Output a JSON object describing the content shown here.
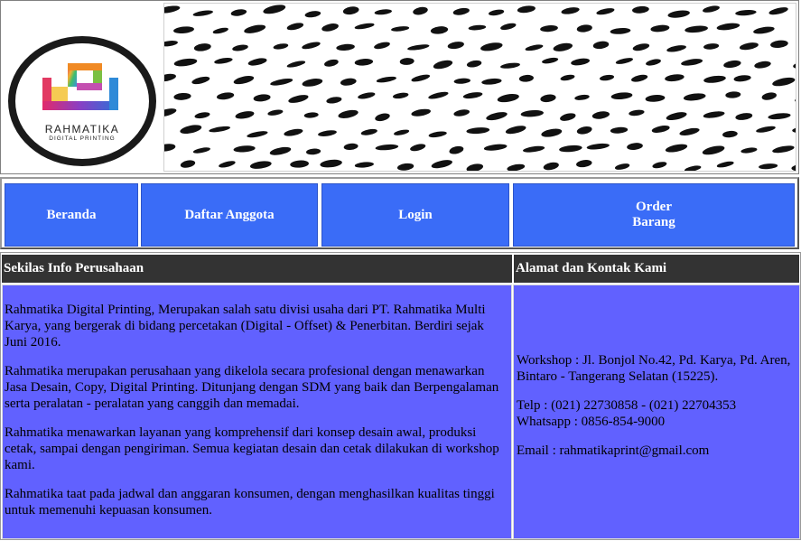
{
  "logo": {
    "name": "RAHMATIKA",
    "tagline": "DIGITAL PRINTING"
  },
  "nav": {
    "items": [
      {
        "label": "Beranda"
      },
      {
        "label": "Daftar Anggota"
      },
      {
        "label": "Login"
      },
      {
        "label": "Order Barang"
      }
    ]
  },
  "info": {
    "heading": "Sekilas Info Perusahaan",
    "paragraphs": [
      "Rahmatika Digital Printing, Merupakan salah satu divisi usaha dari PT. Rahmatika Multi Karya, yang bergerak di bidang percetakan (Digital - Offset) & Penerbitan. Berdiri sejak Juni 2016.",
      "Rahmatika merupakan perusahaan yang dikelola secara profesional dengan menawarkan Jasa Desain, Copy, Digital Printing. Ditunjang dengan SDM yang baik dan Berpengalaman serta peralatan - peralatan yang canggih dan memadai.",
      "Rahmatika menawarkan layanan yang komprehensif dari konsep desain awal, produksi cetak, sampai dengan pengiriman. Semua kegiatan desain dan cetak dilakukan di workshop kami.",
      "Rahmatika taat pada jadwal dan anggaran konsumen, dengan menghasilkan kualitas tinggi untuk memenuhi kepuasan konsumen."
    ]
  },
  "contact": {
    "heading": "Alamat dan Kontak Kami",
    "workshop": "Workshop : Jl. Bonjol No.42, Pd. Karya, Pd. Aren, Bintaro - Tangerang Selatan (15225).",
    "telp": "Telp : (021) 22730858 - (021) 22704353",
    "whatsapp": "Whatsapp : 0856-854-9000",
    "email": "Email : rahmatikaprint@gmail.com"
  },
  "colors": {
    "nav_bg": "#3a6cf7",
    "header_bg": "#333333",
    "content_bg": "#6161ff"
  }
}
